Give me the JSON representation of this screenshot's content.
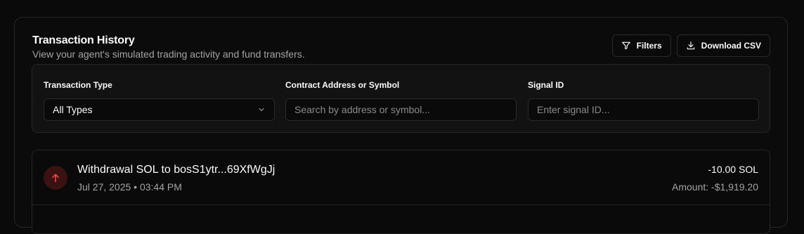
{
  "header": {
    "title": "Transaction History",
    "subtitle": "View your agent's simulated trading activity and fund transfers."
  },
  "actions": {
    "filters_label": "Filters",
    "download_label": "Download CSV"
  },
  "filters": {
    "type": {
      "label": "Transaction Type",
      "value": "All Types"
    },
    "contract": {
      "label": "Contract Address or Symbol",
      "placeholder": "Search by address or symbol..."
    },
    "signal": {
      "label": "Signal ID",
      "placeholder": "Enter signal ID..."
    }
  },
  "transactions": [
    {
      "title": "Withdrawal SOL to bosS1ytr...69XfWgJj",
      "date": "Jul 27, 2025 • 03:44 PM",
      "amount": "-10.00 SOL",
      "value": "Amount: -$1,919.20",
      "icon": "arrow-up-icon"
    }
  ],
  "colors": {
    "background": "#0a0a0a",
    "panel": "#121212",
    "border": "#262626",
    "muted_text": "#a3a3a3",
    "withdrawal_icon": "#ef4444",
    "withdrawal_icon_bg": "#3a1212"
  }
}
